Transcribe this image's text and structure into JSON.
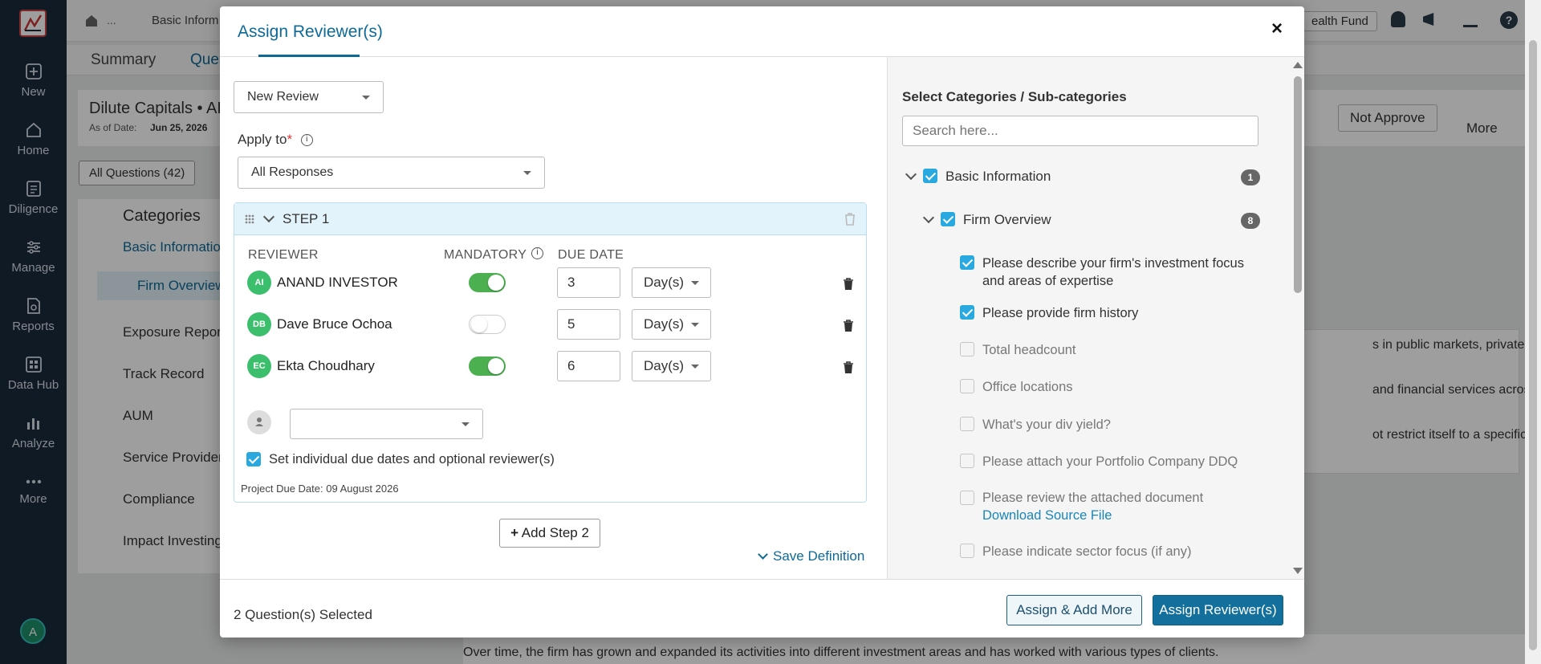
{
  "nav": {
    "items": [
      {
        "label": "New",
        "icon": "plus-square-icon"
      },
      {
        "label": "Home",
        "icon": "home-icon"
      },
      {
        "label": "Diligence",
        "icon": "diligence-icon"
      },
      {
        "label": "Manage",
        "icon": "manage-icon"
      },
      {
        "label": "Reports",
        "icon": "reports-icon"
      },
      {
        "label": "Data Hub",
        "icon": "data-hub-icon"
      },
      {
        "label": "Analyze",
        "icon": "analyze-icon"
      },
      {
        "label": "More",
        "icon": "more-dots-icon"
      }
    ],
    "user_initial": "A"
  },
  "background": {
    "breadcrumb": "Basic Inform",
    "breadcrumb_ellipsis": "...",
    "health_fund": "ealth Fund",
    "tabs": [
      "Summary",
      "Ques"
    ],
    "fund_title": "Dilute Capitals • AI",
    "as_of_label": "As of Date:",
    "as_of_value": "Jun 25, 2026",
    "all_questions": "All Questions (42)",
    "categories_title": "Categories",
    "categories": [
      "Basic Information",
      "Firm Overview",
      "Exposure Reporti",
      "Track Record",
      "AUM",
      "Service Providers",
      "Compliance",
      "Impact Investing a"
    ],
    "not_approve": "Not Approve",
    "more": "More",
    "text_lines": [
      "s in public markets, private",
      "and financial services across",
      "ot restrict itself to a specific style"
    ],
    "bottom_text": "Over time, the firm has grown and expanded its activities into different investment areas and has worked with various types of clients."
  },
  "modal": {
    "title": "Assign Reviewer(s)",
    "review_type": "New Review",
    "apply_to_label": "Apply to",
    "apply_to_required": "*",
    "apply_to_value": "All Responses",
    "step": {
      "title": "STEP 1",
      "col_reviewer": "REVIEWER",
      "col_mandatory": "MANDATORY",
      "col_due": "DUE DATE",
      "reviewers": [
        {
          "initials": "AI",
          "name": "ANAND INVESTOR",
          "mandatory": true,
          "due": "3",
          "unit": "Day(s)"
        },
        {
          "initials": "DB",
          "name": "Dave Bruce Ochoa",
          "mandatory": false,
          "due": "5",
          "unit": "Day(s)"
        },
        {
          "initials": "EC",
          "name": "Ekta Choudhary",
          "mandatory": true,
          "due": "6",
          "unit": "Day(s)"
        }
      ],
      "individual_label": "Set individual due dates and optional reviewer(s)",
      "project_due": "Project Due Date: 09 August 2026"
    },
    "add_step": "Add Step 2",
    "save_definition": "Save Definition",
    "selected_count": "2 Question(s) Selected",
    "assign_add_more": "Assign & Add More",
    "assign_reviewers": "Assign Reviewer(s)",
    "right": {
      "heading": "Select Categories / Sub-categories",
      "search_placeholder": "Search here...",
      "category": {
        "label": "Basic Information",
        "count": "1"
      },
      "subcategory": {
        "label": "Firm Overview",
        "count": "8"
      },
      "questions": [
        {
          "text": "Please describe your firm's investment focus",
          "text2": "and areas of expertise",
          "checked": true
        },
        {
          "text": "Please provide firm history",
          "checked": true
        },
        {
          "text": "Total headcount",
          "checked": false
        },
        {
          "text": "Office locations",
          "checked": false
        },
        {
          "text": "What's your div yield?",
          "checked": false
        },
        {
          "text": "Please attach your Portfolio Company DDQ",
          "checked": false
        },
        {
          "text": "Please review the attached document",
          "link": "Download Source File",
          "checked": false
        },
        {
          "text": "Please indicate sector focus (if any)",
          "checked": false
        }
      ]
    }
  },
  "colors": {
    "accent": "#0d6a96",
    "toggle_on": "#4caf50",
    "check": "#29a9e0",
    "nav_bg": "#1b2a3a"
  }
}
